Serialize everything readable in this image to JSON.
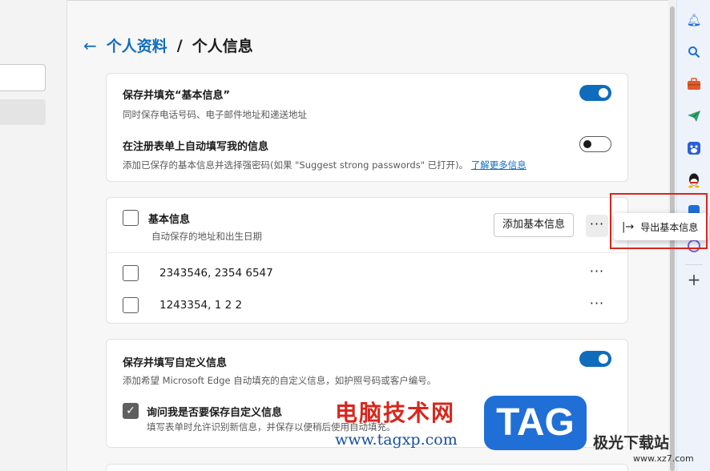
{
  "breadcrumb": {
    "parent": "个人资料",
    "separator": "/",
    "current": "个人信息"
  },
  "card1": {
    "row1_title": "保存并填充“基本信息”",
    "row1_desc": "同时保存电话号码、电子邮件地址和递送地址",
    "row1_toggle": "on",
    "row2_title": "在注册表单上自动填写我的信息",
    "row2_desc": "添加已保存的基本信息并选择强密码(如果 \"Suggest strong passwords\" 已打开)。",
    "row2_link": "了解更多信息",
    "row2_toggle": "off"
  },
  "card2": {
    "title": "基本信息",
    "desc": "自动保存的地址和出生日期",
    "add_button": "添加基本信息",
    "more_label": "···",
    "entries": [
      {
        "text": "2343546, 2354 6547",
        "more": "···"
      },
      {
        "text": "1243354, 1 2 2",
        "more": "···"
      }
    ]
  },
  "card3": {
    "title": "保存并填写自定义信息",
    "desc": "添加希望 Microsoft Edge 自动填充的自定义信息，如护照号码或客户编号。",
    "toggle": "on",
    "checkbox_title": "询问我是否要保存自定义信息",
    "checkbox_desc": "填写表单时允许识别新信息，并保存以便稍后使用自动填充。"
  },
  "popup": {
    "icon": "|→",
    "label": "导出基本信息"
  },
  "right_sidebar": {
    "icons": [
      "bell-icon",
      "search-icon",
      "toolbox-icon",
      "send-icon",
      "baidu-icon",
      "qq-icon",
      "app-icon",
      "app2-icon",
      "plus-icon"
    ]
  },
  "watermark": {
    "title": "电脑技术网",
    "url": "www.tagxp.com",
    "badge": "TAG",
    "site_logo": "极光下载站",
    "site_url": "www.xz7.com"
  },
  "colors": {
    "accent": "#0f6cbd",
    "highlight": "#d9261c"
  }
}
